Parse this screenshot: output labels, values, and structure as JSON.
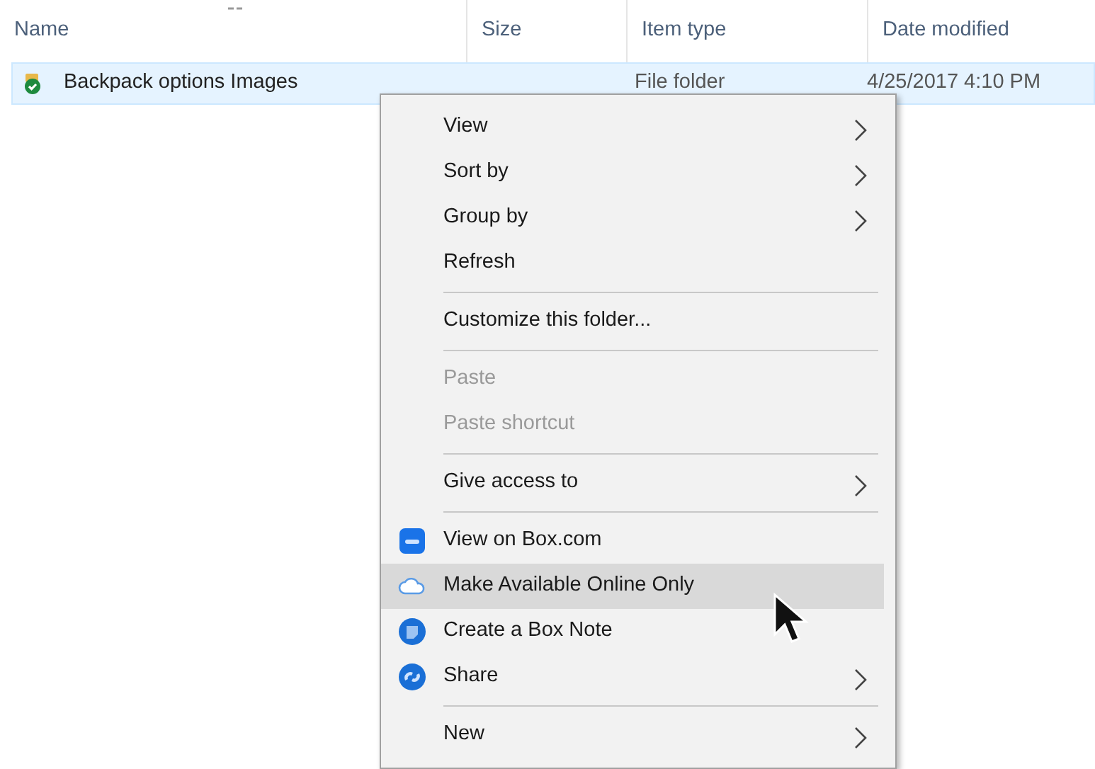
{
  "columns": [
    {
      "label": "Name"
    },
    {
      "label": "Size"
    },
    {
      "label": "Item type"
    },
    {
      "label": "Date modified"
    }
  ],
  "rows": [
    {
      "name": "Backpack options Images",
      "size": "",
      "type": "File folder",
      "date": "4/25/2017 4:10 PM",
      "selected": true,
      "synced": true
    }
  ],
  "context_menu": [
    {
      "kind": "item",
      "label": "View",
      "submenu": true,
      "disabled": false,
      "selected": false
    },
    {
      "kind": "item",
      "label": "Sort by",
      "submenu": true,
      "disabled": false,
      "selected": false
    },
    {
      "kind": "item",
      "label": "Group by",
      "submenu": true,
      "disabled": false,
      "selected": false
    },
    {
      "kind": "item",
      "label": "Refresh",
      "submenu": false,
      "disabled": false,
      "selected": false
    },
    {
      "kind": "separator"
    },
    {
      "kind": "item",
      "label": "Customize this folder...",
      "submenu": false,
      "disabled": false,
      "selected": false
    },
    {
      "kind": "separator"
    },
    {
      "kind": "item",
      "label": "Paste",
      "submenu": false,
      "disabled": true,
      "selected": false
    },
    {
      "kind": "item",
      "label": "Paste shortcut",
      "submenu": false,
      "disabled": true,
      "selected": false
    },
    {
      "kind": "separator"
    },
    {
      "kind": "item",
      "label": "Give access to",
      "submenu": true,
      "disabled": false,
      "selected": false
    },
    {
      "kind": "separator"
    },
    {
      "kind": "boxlink",
      "label": "View on Box.com",
      "submenu": false,
      "disabled": false,
      "selected": false
    },
    {
      "kind": "cloud",
      "label": "Make Available Online Only",
      "submenu": false,
      "disabled": false,
      "selected": true
    },
    {
      "kind": "note",
      "label": "Create a Box Note",
      "submenu": false,
      "disabled": false,
      "selected": false
    },
    {
      "kind": "share",
      "label": "Share",
      "submenu": true,
      "disabled": false,
      "selected": false
    },
    {
      "kind": "separator"
    },
    {
      "kind": "item",
      "label": "New",
      "submenu": true,
      "disabled": false,
      "selected": false
    }
  ]
}
